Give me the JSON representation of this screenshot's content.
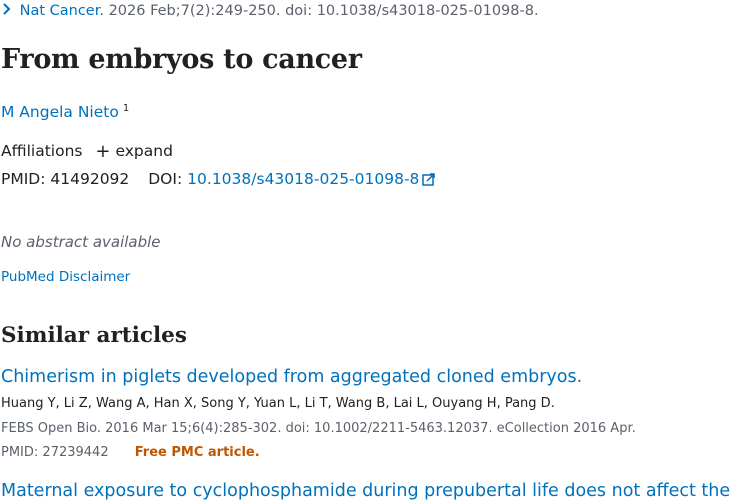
{
  "citation": {
    "journal": "Nat Cancer.",
    "details": "2026 Feb;7(2):249-250. doi: 10.1038/s43018-025-01098-8."
  },
  "title": "From embryos to cancer",
  "author": {
    "name": "M Angela Nieto",
    "affiliation_ref": "1"
  },
  "affiliations": {
    "label": "Affiliations",
    "expand_label": "expand"
  },
  "identifiers": {
    "pmid_label": "PMID:",
    "pmid": "41492092",
    "doi_label": "DOI:",
    "doi": "10.1038/s43018-025-01098-8"
  },
  "abstract_text": "No abstract available",
  "disclaimer_link": "PubMed Disclaimer",
  "similar_articles": {
    "heading": "Similar articles",
    "items": [
      {
        "title": "Chimerism in piglets developed from aggregated cloned embryos.",
        "authors": "Huang Y, Li Z, Wang A, Han X, Song Y, Yuan L, Li T, Wang B, Lai L, Ouyang H, Pang D.",
        "citation": "FEBS Open Bio. 2016 Mar 15;6(4):285-302. doi: 10.1002/2211-5463.12037. eCollection 2016 Apr.",
        "pmid_label": "PMID:",
        "pmid": "27239442",
        "free_label": "Free PMC article."
      },
      {
        "title": "Maternal exposure to cyclophosphamide during prepubertal life does not affect the"
      }
    ]
  },
  "colors": {
    "link": "#0071bc",
    "text": "#212121",
    "muted": "#5b616b",
    "free_pmc": "#c05600"
  },
  "icons": [
    "chevron-right-icon",
    "plus-icon",
    "external-link-icon"
  ]
}
